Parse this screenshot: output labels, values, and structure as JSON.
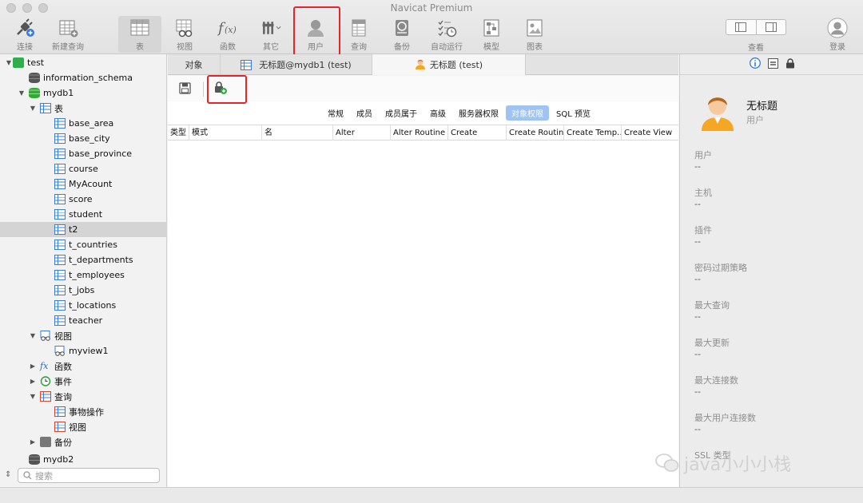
{
  "window": {
    "title": "Navicat Premium"
  },
  "toolbar": {
    "buttons": [
      {
        "label": "连接",
        "icon": "plug-icon"
      },
      {
        "label": "新建查询",
        "icon": "new-query-icon"
      },
      {
        "label": "表",
        "icon": "table-icon"
      },
      {
        "label": "视图",
        "icon": "view-icon"
      },
      {
        "label": "函数",
        "icon": "function-icon"
      },
      {
        "label": "其它",
        "icon": "tools-icon"
      },
      {
        "label": "用户",
        "icon": "user-icon"
      },
      {
        "label": "查询",
        "icon": "query-icon"
      },
      {
        "label": "备份",
        "icon": "backup-icon"
      },
      {
        "label": "自动运行",
        "icon": "schedule-icon"
      },
      {
        "label": "模型",
        "icon": "model-icon"
      },
      {
        "label": "图表",
        "icon": "chart-icon"
      }
    ],
    "view_label": "查看",
    "login_label": "登录"
  },
  "sidebar": {
    "items": [
      {
        "label": "test"
      },
      {
        "label": "information_schema"
      },
      {
        "label": "mydb1"
      },
      {
        "label": "表"
      },
      {
        "label": "base_area"
      },
      {
        "label": "base_city"
      },
      {
        "label": "base_province"
      },
      {
        "label": "course"
      },
      {
        "label": "MyAcount"
      },
      {
        "label": "score"
      },
      {
        "label": "student"
      },
      {
        "label": "t2"
      },
      {
        "label": "t_countries"
      },
      {
        "label": "t_departments"
      },
      {
        "label": "t_employees"
      },
      {
        "label": "t_jobs"
      },
      {
        "label": "t_locations"
      },
      {
        "label": "teacher"
      },
      {
        "label": "视图"
      },
      {
        "label": "myview1"
      },
      {
        "label": "函数"
      },
      {
        "label": "事件"
      },
      {
        "label": "查询"
      },
      {
        "label": "事物操作"
      },
      {
        "label": "视图"
      },
      {
        "label": "备份"
      },
      {
        "label": "mydb2"
      }
    ],
    "search_placeholder": "搜索"
  },
  "tabs": [
    {
      "label": "对象"
    },
    {
      "label": "无标题@mydb1 (test)"
    },
    {
      "label": "无标题 (test)"
    }
  ],
  "subtabs": [
    "常规",
    "成员",
    "成员属于",
    "高级",
    "服务器权限",
    "对象权限",
    "SQL 预览"
  ],
  "grid": {
    "columns": [
      "类型",
      "模式",
      "名",
      "Alter",
      "Alter Routine",
      "Create",
      "Create Routine",
      "Create Temp…",
      "Create View"
    ]
  },
  "right_panel": {
    "name": "无标题",
    "type": "用户",
    "fields": [
      {
        "label": "用户",
        "value": "--"
      },
      {
        "label": "主机",
        "value": "--"
      },
      {
        "label": "插件",
        "value": "--"
      },
      {
        "label": "密码过期策略",
        "value": "--"
      },
      {
        "label": "最大查询",
        "value": "--"
      },
      {
        "label": "最大更新",
        "value": "--"
      },
      {
        "label": "最大连接数",
        "value": "--"
      },
      {
        "label": "最大用户连接数",
        "value": "--"
      },
      {
        "label": "SSL 类型",
        "value": ""
      }
    ]
  },
  "watermark": {
    "text": "java小小小栈"
  },
  "colors": {
    "highlight": "#e8242b",
    "active_subtab": "#9fc3f2",
    "selection": "#d4d4d4"
  }
}
